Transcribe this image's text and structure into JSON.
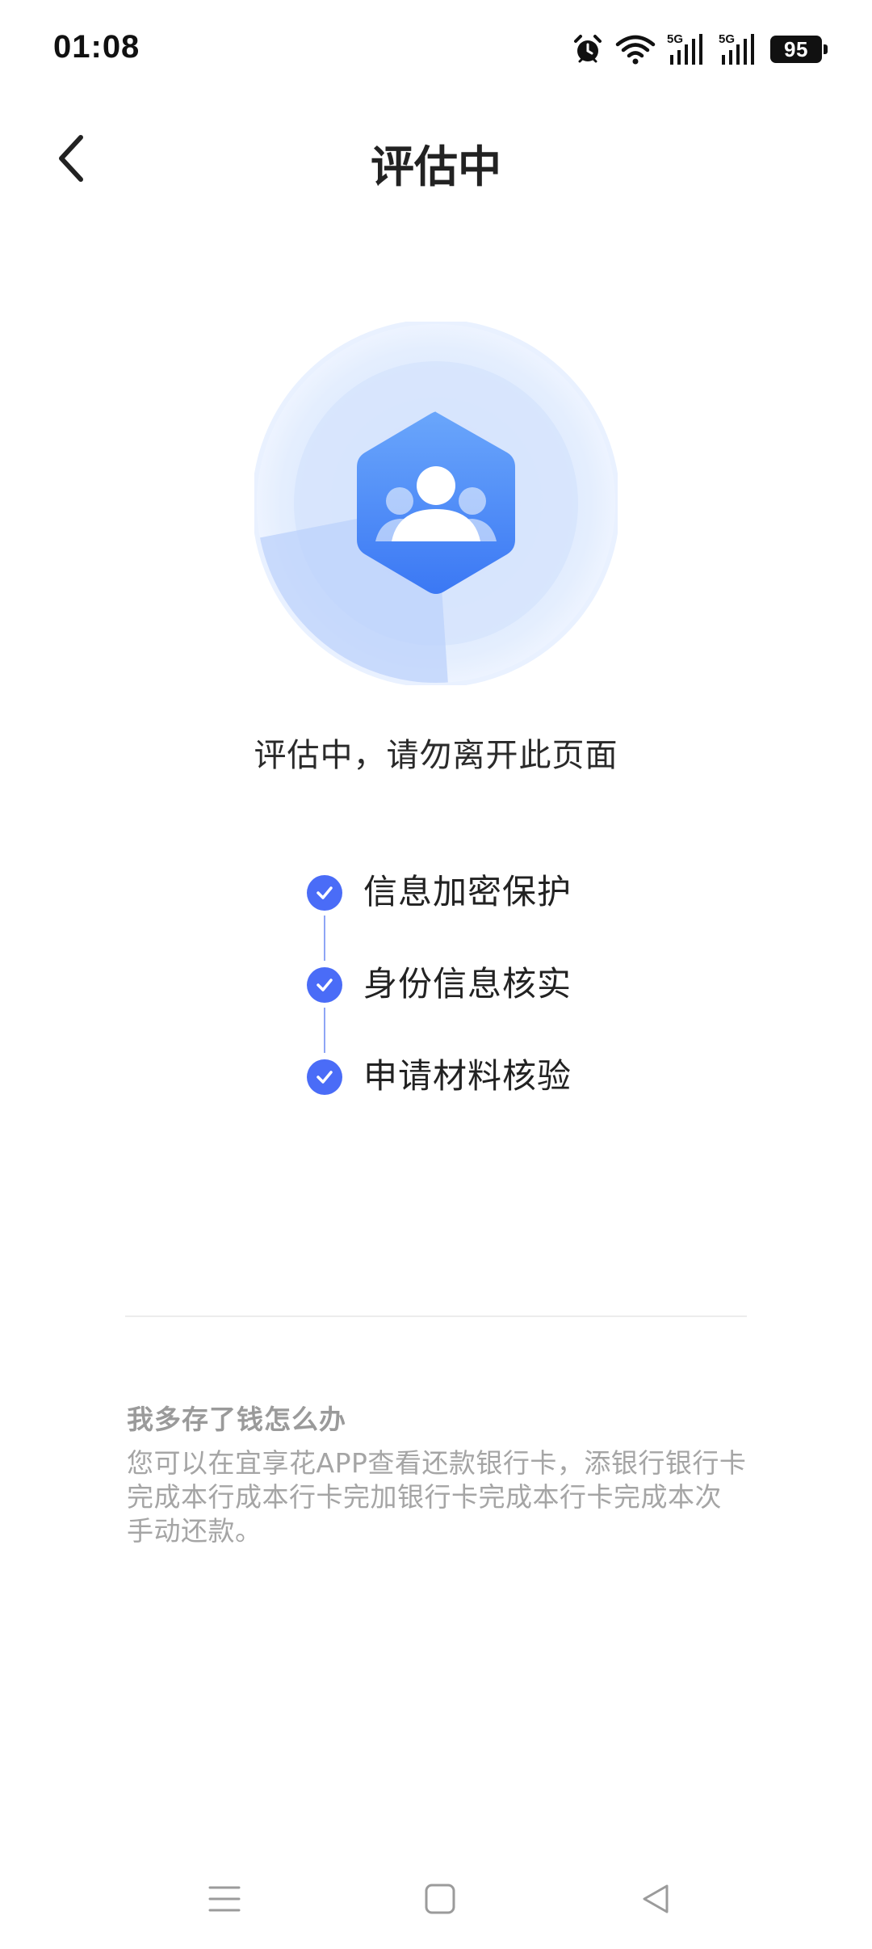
{
  "status_bar": {
    "time": "01:08",
    "battery_level": "95",
    "network_label_1": "5G",
    "network_label_2": "5G"
  },
  "header": {
    "title": "评估中",
    "back_icon": "chevron-left-icon"
  },
  "illustration": {
    "icon": "user-group-hexagon-icon",
    "colors": {
      "primary": "#4a7df7",
      "light": "#d9e6fd"
    }
  },
  "status_text": "评估中，请勿离开此页面",
  "steps": [
    {
      "label": "信息加密保护",
      "done": true
    },
    {
      "label": "身份信息核实",
      "done": true
    },
    {
      "label": "申请材料核验",
      "done": true
    }
  ],
  "faq": {
    "title": "我多存了钱怎么办",
    "body": "您可以在宜享花APP查看还款银行卡，添银行银行卡完成本行成本行卡完加银行卡完成本行卡完成本次手动还款。"
  },
  "nav_bar": {
    "icons": [
      "menu-icon",
      "home-icon",
      "back-triangle-icon"
    ]
  },
  "colors": {
    "accent": "#4a6cf7",
    "text": "#222222",
    "muted": "#a5a5a5"
  }
}
